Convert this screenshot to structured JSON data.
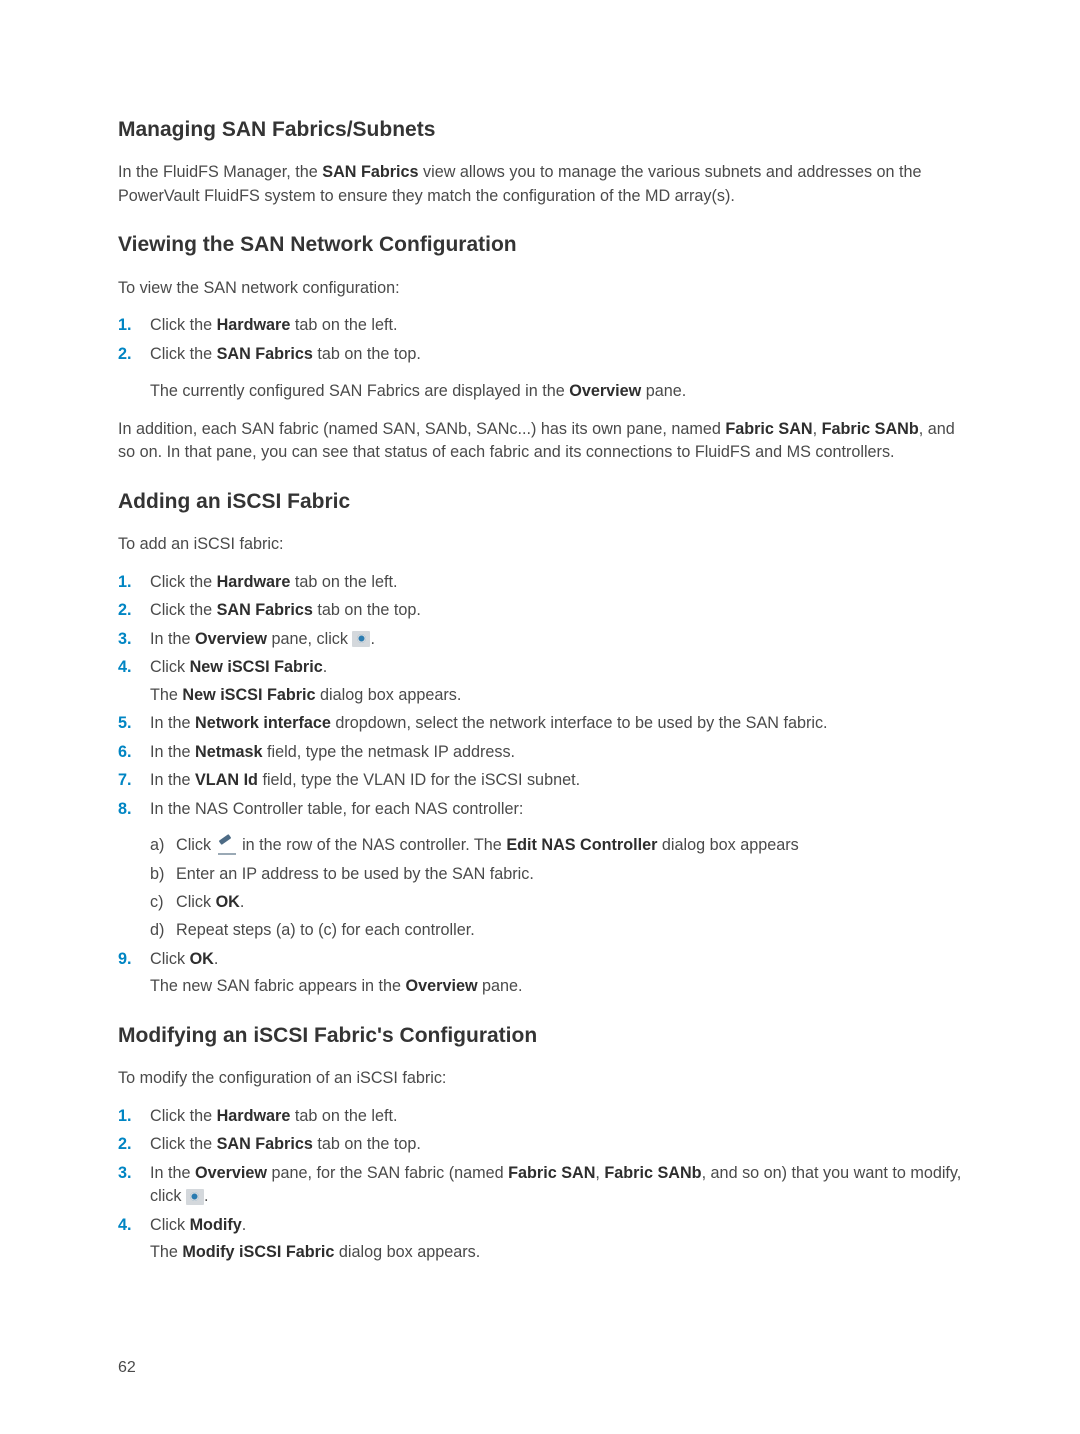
{
  "s1": {
    "title": "Managing SAN Fabrics/Subnets",
    "p1a": "In the FluidFS Manager, the ",
    "p1b": "SAN Fabrics",
    "p1c": " view allows you to manage the various subnets and addresses on the PowerVault FluidFS system to ensure they match the configuration of the MD array(s)."
  },
  "s2": {
    "title": "Viewing the SAN Network Configuration",
    "intro": "To view the SAN network configuration:",
    "step1a": "Click the ",
    "step1b": "Hardware",
    "step1c": " tab on the left.",
    "step2a": "Click the ",
    "step2b": "SAN Fabrics",
    "step2c": " tab on the top.",
    "step2_under_a": "The currently configured SAN Fabrics are displayed in the ",
    "step2_under_b": "Overview",
    "step2_under_c": " pane.",
    "p2a": "In addition, each SAN fabric (named SAN, SANb, SANc...) has its own pane, named ",
    "p2b": "Fabric SAN",
    "p2c": ", ",
    "p2d": "Fabric SANb",
    "p2e": ", and so on. In that pane, you can see that status of each fabric and its connections to FluidFS and MS controllers."
  },
  "s3": {
    "title": "Adding an iSCSI Fabric",
    "intro": "To add an iSCSI fabric:",
    "step1a": "Click the ",
    "step1b": "Hardware",
    "step1c": " tab on the left.",
    "step2a": "Click the ",
    "step2b": "SAN Fabrics",
    "step2c": " tab on the top.",
    "step3a": "In the ",
    "step3b": "Overview",
    "step3c": " pane, click ",
    "step3d": ".",
    "step4a": "Click ",
    "step4b": "New iSCSI Fabric",
    "step4c": ".",
    "step4_under_a": "The ",
    "step4_under_b": "New iSCSI Fabric",
    "step4_under_c": " dialog box appears.",
    "step5a": "In the ",
    "step5b": "Network interface",
    "step5c": " dropdown, select the network interface to be used by the SAN fabric.",
    "step6a": "In the ",
    "step6b": "Netmask",
    "step6c": " field, type the netmask IP address.",
    "step7a": "In the ",
    "step7b": "VLAN Id",
    "step7c": " field, type the VLAN ID for the iSCSI subnet.",
    "step8": "In the NAS Controller table, for each NAS controller:",
    "sub_a1": "Click ",
    "sub_a2": " in the row of the NAS controller. The ",
    "sub_a3": "Edit NAS Controller",
    "sub_a4": " dialog box appears",
    "sub_b": "Enter an IP address to be used by the SAN fabric.",
    "sub_c1": "Click ",
    "sub_c2": "OK",
    "sub_c3": ".",
    "sub_d": "Repeat steps (a) to (c) for each controller.",
    "step9a": "Click ",
    "step9b": "OK",
    "step9c": ".",
    "step9_under_a": "The new SAN fabric appears in the ",
    "step9_under_b": "Overview",
    "step9_under_c": " pane."
  },
  "s4": {
    "title": "Modifying an iSCSI Fabric's Configuration",
    "intro": "To modify the configuration of an iSCSI fabric:",
    "step1a": "Click the ",
    "step1b": "Hardware",
    "step1c": " tab on the left.",
    "step2a": "Click the ",
    "step2b": "SAN Fabrics",
    "step2c": " tab on the top.",
    "step3a": "In the ",
    "step3b": "Overview",
    "step3c": " pane, for the SAN fabric (named ",
    "step3d": "Fabric SAN",
    "step3e": ", ",
    "step3f": "Fabric SANb",
    "step3g": ", and so on) that you want to modify, click ",
    "step3h": ".",
    "step4a": "Click ",
    "step4b": "Modify",
    "step4c": ".",
    "step4_under_a": "The ",
    "step4_under_b": "Modify iSCSI Fabric",
    "step4_under_c": " dialog box appears."
  },
  "nums": {
    "n1": "1.",
    "n2": "2.",
    "n3": "3.",
    "n4": "4.",
    "n5": "5.",
    "n6": "6.",
    "n7": "7.",
    "n8": "8.",
    "n9": "9."
  },
  "alphas": {
    "a": "a)",
    "b": "b)",
    "c": "c)",
    "d": "d)"
  },
  "page": "62"
}
